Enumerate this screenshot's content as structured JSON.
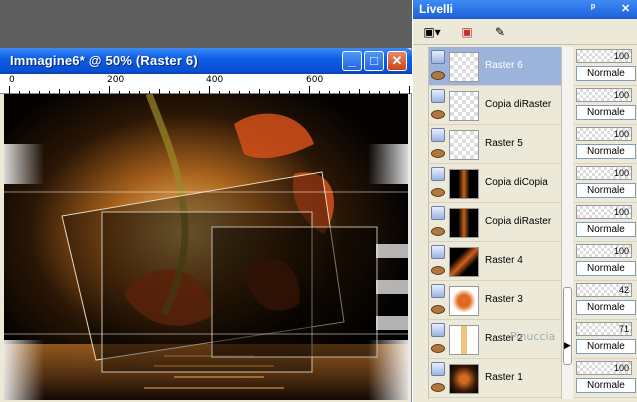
{
  "image_window": {
    "title": "Immagine6* @  50% (Raster 6)",
    "min_label": "_",
    "max_label": "□",
    "close_label": "✕",
    "ruler_ticks": [
      "0",
      "200",
      "400",
      "600"
    ]
  },
  "layers_panel": {
    "title": "Livelli",
    "pin_label": "ᵖ",
    "close_label": "✕",
    "layers": [
      {
        "name": "Raster 6",
        "selected": true,
        "opacity": "100",
        "blend": "Normale"
      },
      {
        "name": "Copia diRaster",
        "selected": false,
        "opacity": "100",
        "blend": "Normale"
      },
      {
        "name": "Raster 5",
        "selected": false,
        "opacity": "100",
        "blend": "Normale"
      },
      {
        "name": "Copia diCopia",
        "selected": false,
        "opacity": "100",
        "blend": "Normale"
      },
      {
        "name": "Copia diRaster",
        "selected": false,
        "opacity": "100",
        "blend": "Normale"
      },
      {
        "name": "Raster 4",
        "selected": false,
        "opacity": "100",
        "blend": "Normale"
      },
      {
        "name": "Raster 3",
        "selected": false,
        "opacity": "42",
        "blend": "Normale"
      },
      {
        "name": "Raster 2",
        "selected": false,
        "opacity": "71",
        "blend": "Normale"
      },
      {
        "name": "Raster 1",
        "selected": false,
        "opacity": "100",
        "blend": "Normale"
      }
    ]
  },
  "watermark": "Pinuccia",
  "colors": {
    "titlebar": "#0a4fd0",
    "selected_layer": "#9cb4dc"
  }
}
